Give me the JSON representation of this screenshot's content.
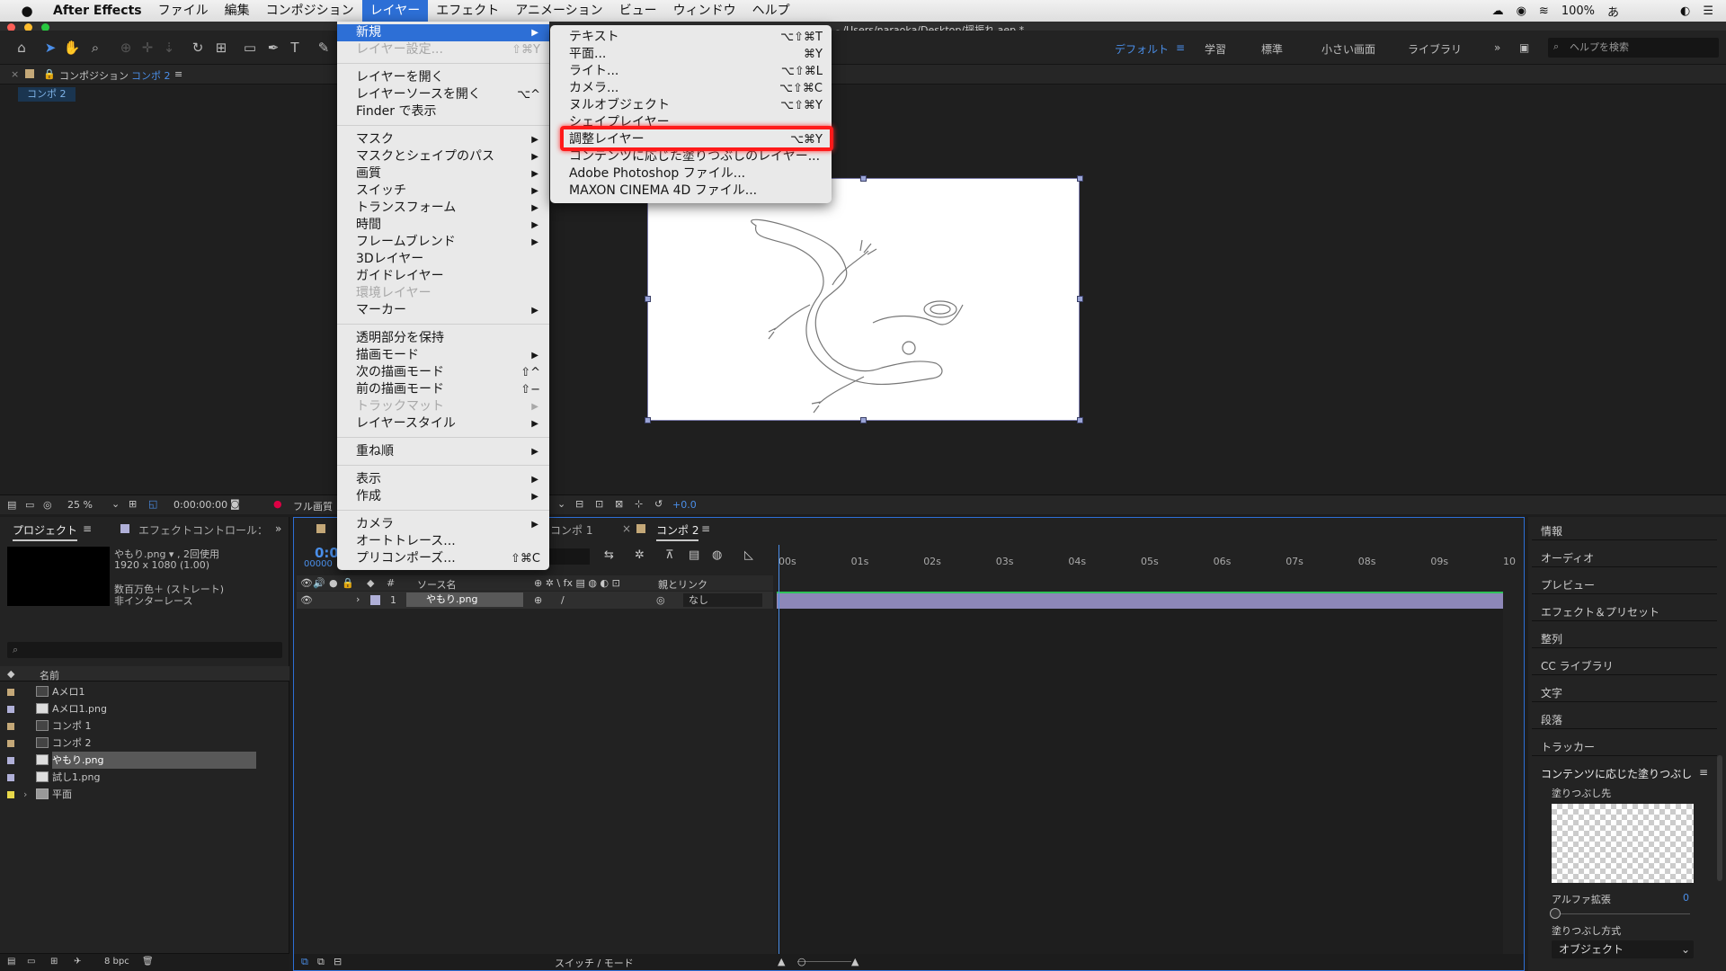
{
  "menubar": {
    "app": "After Effects",
    "items": [
      "ファイル",
      "編集",
      "コンポジション",
      "レイヤー",
      "エフェクト",
      "アニメーション",
      "ビュー",
      "ウィンドウ",
      "ヘルプ"
    ],
    "battery": "100%"
  },
  "window_title": "- /Users/naraoka/Desktop/揺振れ.aep *",
  "workspaces": [
    "デフォルト",
    "学習",
    "標準",
    "小さい画面",
    "ライブラリ"
  ],
  "help_search_placeholder": "ヘルプを検索",
  "comp_panel": {
    "tab_prefix": "コンポジション",
    "tab_name": "コンポ 2",
    "subtab": "コンポ 2"
  },
  "comp_footer": {
    "zoom": "25 %",
    "timecode": "0:00:00:00",
    "quality": "フル画質",
    "exposure": "+0.0"
  },
  "layer_menu": {
    "items": [
      {
        "label": "新規",
        "arrow": true,
        "highlight": true
      },
      {
        "label": "レイヤー設定...",
        "shortcut": "⇧⌘Y",
        "disabled": true
      },
      {
        "sep": true
      },
      {
        "label": "レイヤーを開く"
      },
      {
        "label": "レイヤーソースを開く",
        "shortcut": "⌥^"
      },
      {
        "label": "Finder で表示"
      },
      {
        "sep": true
      },
      {
        "label": "マスク",
        "arrow": true
      },
      {
        "label": "マスクとシェイプのパス",
        "arrow": true
      },
      {
        "label": "画質",
        "arrow": true
      },
      {
        "label": "スイッチ",
        "arrow": true
      },
      {
        "label": "トランスフォーム",
        "arrow": true
      },
      {
        "label": "時間",
        "arrow": true
      },
      {
        "label": "フレームブレンド",
        "arrow": true
      },
      {
        "label": "3Dレイヤー"
      },
      {
        "label": "ガイドレイヤー"
      },
      {
        "label": "環境レイヤー",
        "disabled": true
      },
      {
        "label": "マーカー",
        "arrow": true
      },
      {
        "sep": true
      },
      {
        "label": "透明部分を保持"
      },
      {
        "label": "描画モード",
        "arrow": true
      },
      {
        "label": "次の描画モード",
        "shortcut": "⇧^"
      },
      {
        "label": "前の描画モード",
        "shortcut": "⇧−"
      },
      {
        "label": "トラックマット",
        "arrow": true,
        "disabled": true
      },
      {
        "label": "レイヤースタイル",
        "arrow": true
      },
      {
        "sep": true
      },
      {
        "label": "重ね順",
        "arrow": true
      },
      {
        "sep": true
      },
      {
        "label": "表示",
        "arrow": true
      },
      {
        "label": "作成",
        "arrow": true
      },
      {
        "sep": true
      },
      {
        "label": "カメラ",
        "arrow": true
      },
      {
        "label": "オートトレース..."
      },
      {
        "label": "プリコンポーズ...",
        "shortcut": "⇧⌘C"
      }
    ]
  },
  "new_submenu": {
    "items": [
      {
        "label": "テキスト",
        "shortcut": "⌥⇧⌘T"
      },
      {
        "label": "平面...",
        "shortcut": "⌘Y"
      },
      {
        "label": "ライト...",
        "shortcut": "⌥⇧⌘L"
      },
      {
        "label": "カメラ...",
        "shortcut": "⌥⇧⌘C"
      },
      {
        "label": "ヌルオブジェクト",
        "shortcut": "⌥⇧⌘Y"
      },
      {
        "label": "シェイプレイヤー"
      },
      {
        "label": "調整レイヤー",
        "shortcut": "⌥⌘Y",
        "callout": true
      },
      {
        "label": "コンテンツに応じた塗りつぶしのレイヤー..."
      },
      {
        "label": "Adobe Photoshop ファイル..."
      },
      {
        "label": "MAXON CINEMA 4D ファイル..."
      }
    ]
  },
  "project": {
    "tab": "プロジェクト",
    "tab2": "エフェクトコントロール：",
    "info_name": "やもり.png ▾ , 2回使用",
    "info_size": "1920 x 1080 (1.00)",
    "info_color": "数百万色＋ (ストレート)",
    "info_scan": "非インターレース",
    "col_name": "名前",
    "bpc": "8 bpc",
    "items": [
      {
        "name": "Aメロ1",
        "color": "#c4a878",
        "type": "comp"
      },
      {
        "name": "Aメロ1.png",
        "color": "#b0b0d8",
        "type": "file"
      },
      {
        "name": "コンポ 1",
        "color": "#c4a878",
        "type": "comp"
      },
      {
        "name": "コンポ 2",
        "color": "#c4a878",
        "type": "comp"
      },
      {
        "name": "やもり.png",
        "color": "#b0b0d8",
        "type": "file",
        "selected": true
      },
      {
        "name": "試し1.png",
        "color": "#b0b0d8",
        "type": "file"
      },
      {
        "name": "平面",
        "color": "#e8d84a",
        "type": "folder"
      }
    ]
  },
  "timeline": {
    "tabs": [
      "コンポ 1",
      "コンポ 2"
    ],
    "timecode": "0:0",
    "frames": "00000",
    "col_source": "ソース名",
    "col_parent": "親とリンク",
    "layer_num": "1",
    "layer_name": "やもり.png",
    "parent_value": "なし",
    "ruler": [
      "00s",
      "01s",
      "02s",
      "03s",
      "04s",
      "05s",
      "06s",
      "07s",
      "08s",
      "09s",
      "10"
    ],
    "footer": "スイッチ / モード"
  },
  "right_panels": {
    "items": [
      "情報",
      "オーディオ",
      "プレビュー",
      "エフェクト＆プリセット",
      "整列",
      "CC ライブラリ",
      "文字",
      "段落",
      "トラッカー"
    ],
    "fill_title": "コンテンツに応じた塗りつぶし",
    "fill_target": "塗りつぶし先",
    "alpha_label": "アルファ拡張",
    "alpha_value": "0",
    "fill_method_label": "塗りつぶし方式",
    "fill_method_value": "オブジェクト"
  }
}
